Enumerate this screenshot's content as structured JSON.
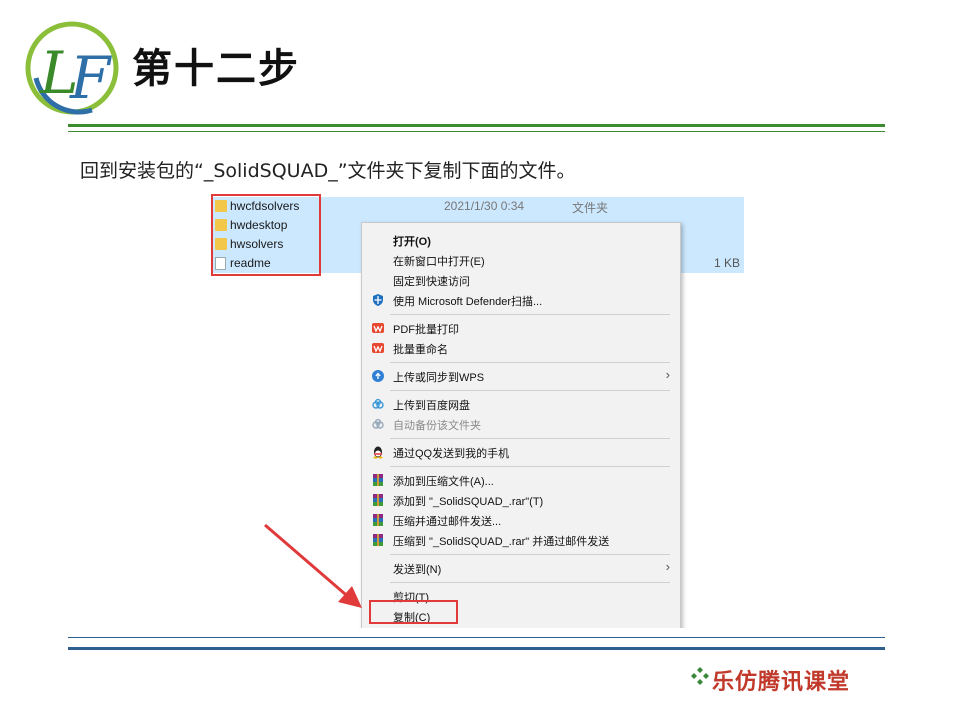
{
  "slide": {
    "logo_text": "LF",
    "title": "第十二步",
    "instruction": "回到安装包的“_SolidSQUAD_”文件夹下复制下面的文件。",
    "brand": "乐仿腾讯课堂"
  },
  "colors": {
    "green_rule": "#3d8b2f",
    "blue_rule": "#2e5f8e",
    "highlight": "#e03a3a",
    "selection": "#cce8ff",
    "brand": "#c0392b"
  },
  "files": [
    {
      "name": "hwcfdsolvers",
      "date": "2021/1/30 0:34",
      "type": "文件夹",
      "size": "",
      "icon": "folder-icon"
    },
    {
      "name": "hwdesktop",
      "date": "",
      "type": "",
      "size": "",
      "icon": "folder-icon"
    },
    {
      "name": "hwsolvers",
      "date": "",
      "type": "",
      "size": "",
      "icon": "folder-icon"
    },
    {
      "name": "readme",
      "date": "",
      "type": "",
      "size": "1 KB",
      "icon": "document-icon"
    }
  ],
  "context_menu": {
    "items": [
      {
        "label": "打开(O)",
        "bold": true
      },
      {
        "label": "在新窗口中打开(E)"
      },
      {
        "label": "固定到快速访问"
      },
      {
        "label": "使用 Microsoft Defender扫描...",
        "icon": "defender-shield-icon"
      },
      {
        "label": "PDF批量打印",
        "icon": "wps-icon"
      },
      {
        "label": "批量重命名",
        "icon": "wps-icon"
      },
      {
        "label": "上传或同步到WPS",
        "icon": "wps-cloud-icon",
        "submenu": true
      },
      {
        "label": "上传到百度网盘",
        "icon": "baidu-cloud-icon"
      },
      {
        "label": "自动备份该文件夹",
        "icon": "baidu-cloud-icon",
        "disabled": true
      },
      {
        "label": "通过QQ发送到我的手机",
        "icon": "qq-icon"
      },
      {
        "label": "添加到压缩文件(A)...",
        "icon": "winrar-icon"
      },
      {
        "label": "添加到 \"_SolidSQUAD_.rar\"(T)",
        "icon": "winrar-icon"
      },
      {
        "label": "压缩并通过邮件发送...",
        "icon": "winrar-icon"
      },
      {
        "label": "压缩到 \"_SolidSQUAD_.rar\" 并通过邮件发送",
        "icon": "winrar-icon"
      },
      {
        "label": "发送到(N)",
        "submenu": true
      },
      {
        "label": "剪切(T)"
      },
      {
        "label": "复制(C)"
      }
    ]
  }
}
